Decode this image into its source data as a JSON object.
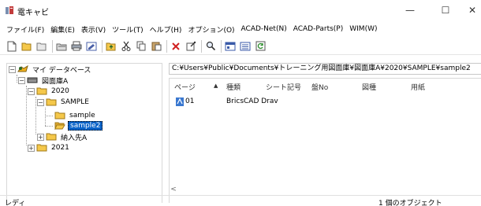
{
  "window": {
    "title": "電キャビ",
    "minimize_glyph": "—",
    "maximize_glyph": "☐",
    "close_glyph": "✕"
  },
  "menu": {
    "items": [
      "ファイル(F)",
      "編集(E)",
      "表示(V)",
      "ツール(T)",
      "ヘルプ(H)",
      "オプション(O)",
      "ACAD-Net(N)",
      "ACAD-Parts(P)",
      "WIM(W)"
    ]
  },
  "toolbar": {
    "icons": [
      "new-icon",
      "open-icon",
      "folder-icon",
      "save-icon",
      "print-icon",
      "edit-icon",
      "up-folder-icon",
      "cut-icon",
      "copy-icon",
      "paste-icon",
      "delete-icon",
      "properties-icon",
      "search-icon",
      "view-icon",
      "detail-view-icon",
      "refresh-icon"
    ]
  },
  "tree": {
    "root": "マイ データベース",
    "db": "図面庫A",
    "year1": "2020",
    "sample": "SAMPLE",
    "sample_child1": "sample",
    "sample_child2": "sample2",
    "delivery": "納入先A",
    "year2": "2021"
  },
  "path": {
    "value": "C:¥Users¥Public¥Documents¥トレーニング用図面庫¥図面庫A¥2020¥SAMPLE¥sample2"
  },
  "list": {
    "sort_glyph": "▲",
    "headers": [
      "ページ",
      "種類",
      "シート記号",
      "盤No",
      "図種",
      "用紙"
    ],
    "rows": [
      {
        "page": "01",
        "type": "BricsCAD Drav"
      }
    ]
  },
  "scroll": {
    "left_glyph": "<"
  },
  "status": {
    "left": "レディ",
    "right": "1 個のオブジェクト"
  },
  "colors": {
    "selection": "#0a63c8",
    "folder": "#f5c84a"
  }
}
